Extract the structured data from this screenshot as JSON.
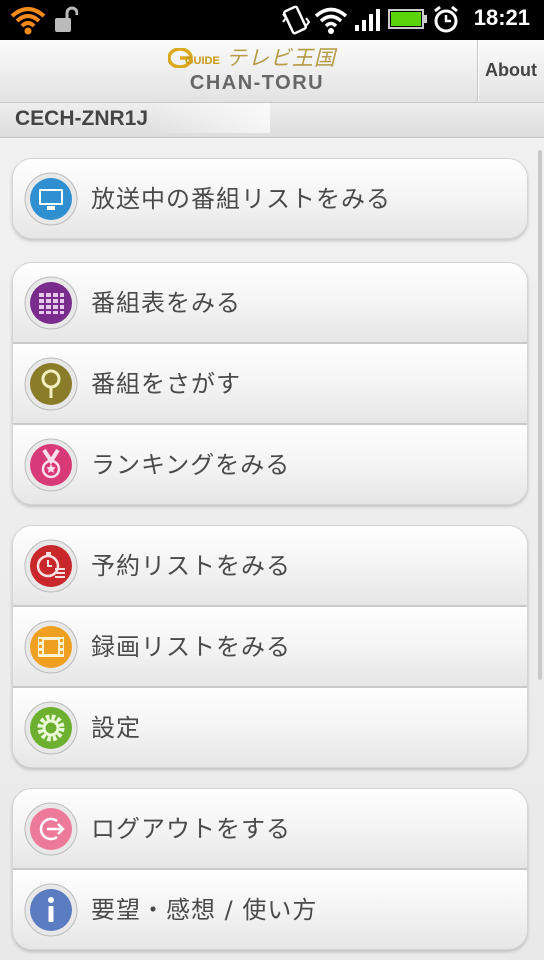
{
  "status_bar": {
    "time": "18:21",
    "icons": [
      "wifi-alert-icon",
      "unlock-icon",
      "vibrate-icon",
      "wifi-icon",
      "signal-icon",
      "battery-icon",
      "alarm-icon"
    ]
  },
  "header": {
    "logo_guide": "GUIDE",
    "logo_title": "テレビ王国",
    "subtitle": "CHAN-TORU",
    "about_label": "About"
  },
  "device": {
    "name": "CECH-ZNR1J"
  },
  "groups": [
    {
      "items": [
        {
          "label": "放送中の番組リストをみる",
          "icon": "tv-monitor-icon",
          "color": "#2f8fd0"
        }
      ]
    },
    {
      "items": [
        {
          "label": "番組表をみる",
          "icon": "program-grid-icon",
          "color": "#7a2c8c"
        },
        {
          "label": "番組をさがす",
          "icon": "magnifier-icon",
          "color": "#8a7d2a"
        },
        {
          "label": "ランキングをみる",
          "icon": "medal-icon",
          "color": "#d83a78"
        }
      ]
    },
    {
      "items": [
        {
          "label": "予約リストをみる",
          "icon": "reservation-timer-icon",
          "color": "#c8282c"
        },
        {
          "label": "録画リストをみる",
          "icon": "film-icon",
          "color": "#f0a020"
        },
        {
          "label": "設定",
          "icon": "gear-icon",
          "color": "#6db030"
        }
      ]
    },
    {
      "items": [
        {
          "label": "ログアウトをする",
          "icon": "logout-icon",
          "color": "#ee7a9a"
        },
        {
          "label": "要望・感想 / 使い方",
          "icon": "info-icon",
          "color": "#5b7cc0"
        }
      ]
    }
  ]
}
